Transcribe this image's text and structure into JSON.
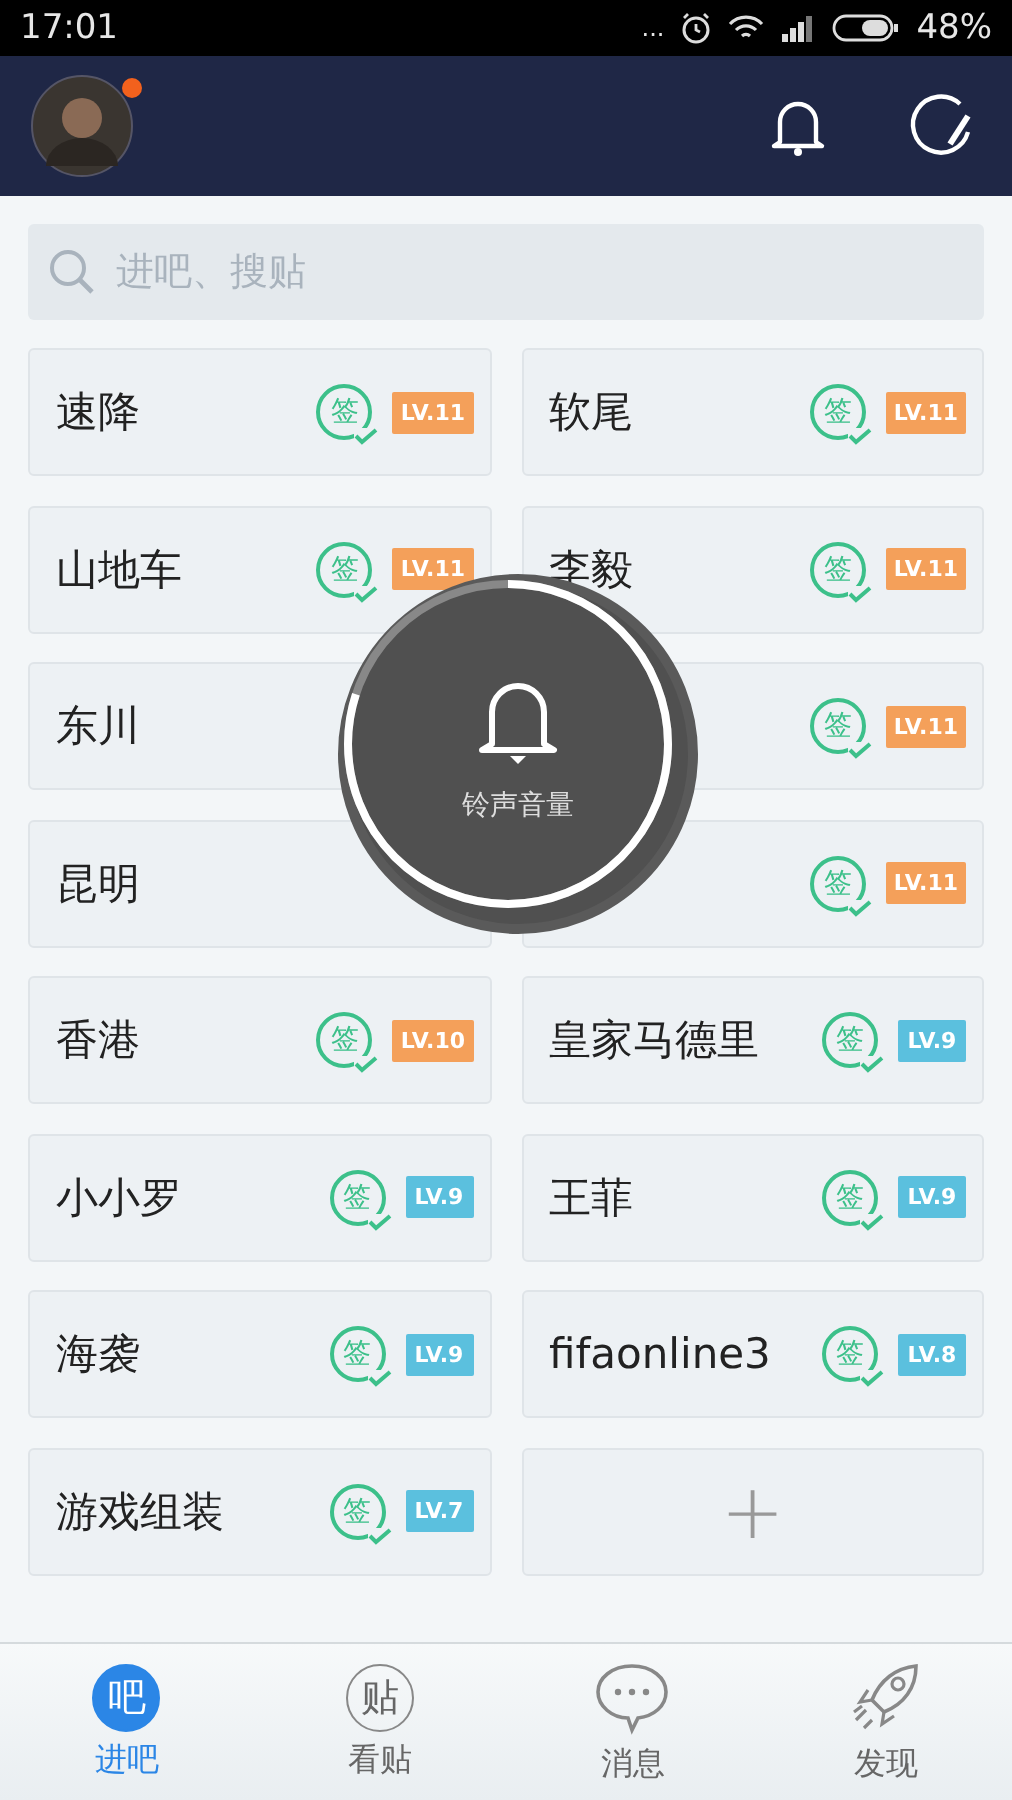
{
  "status_bar": {
    "time": "17:01",
    "dots": "...",
    "battery": "48%"
  },
  "header": {
    "avatar_badge": true
  },
  "search": {
    "placeholder": "进吧、搜贴"
  },
  "forums": [
    {
      "kind": "forum",
      "name": "速降",
      "sign": "签",
      "level_label": "LV.11",
      "color": "#f4a05a"
    },
    {
      "kind": "forum",
      "name": "软尾",
      "sign": "签",
      "level_label": "LV.11",
      "color": "#f4a05a"
    },
    {
      "kind": "forum",
      "name": "山地车",
      "sign": "签",
      "level_label": "LV.11",
      "color": "#f4a05a"
    },
    {
      "kind": "forum",
      "name": "李毅",
      "sign": "签",
      "level_label": "LV.11",
      "color": "#f4a05a"
    },
    {
      "kind": "forum",
      "name": "东川"
    },
    {
      "kind": "forum",
      "sign": "签",
      "level_label": "LV.11",
      "color": "#f4a05a"
    },
    {
      "kind": "forum",
      "name": "昆明"
    },
    {
      "kind": "forum",
      "sign": "签",
      "level_label": "LV.11",
      "color": "#f4a05a"
    },
    {
      "kind": "forum",
      "name": "香港",
      "sign": "签",
      "level_label": "LV.10",
      "color": "#f4a05a"
    },
    {
      "kind": "forum",
      "name": "皇家马德里",
      "sign": "签",
      "level_label": "LV.9",
      "color": "#5bc0de"
    },
    {
      "kind": "forum",
      "name": "小小罗",
      "sign": "签",
      "level_label": "LV.9",
      "color": "#5bc0de"
    },
    {
      "kind": "forum",
      "name": "王菲",
      "sign": "签",
      "level_label": "LV.9",
      "color": "#5bc0de"
    },
    {
      "kind": "forum",
      "name": "海袭",
      "sign": "签",
      "level_label": "LV.9",
      "color": "#5bc0de"
    },
    {
      "kind": "forum",
      "name": "fifaonline3",
      "sign": "签",
      "level_label": "LV.8",
      "color": "#5bc0de"
    },
    {
      "kind": "forum",
      "name": "游戏组装",
      "sign": "签",
      "level_label": "LV.7",
      "color": "#5bc0de"
    },
    {
      "kind": "add",
      "label": "+"
    }
  ],
  "volume_toast": {
    "label": "铃声音量",
    "level": 0.8
  },
  "tabs": [
    {
      "kind": "glyph",
      "icon_text": "吧",
      "label": "进吧",
      "selected": true
    },
    {
      "kind": "glyph",
      "icon_text": "贴",
      "label": "看贴",
      "selected": false
    },
    {
      "kind": "chat",
      "label": "消息",
      "selected": false
    },
    {
      "kind": "rocket",
      "label": "发现",
      "selected": false
    }
  ]
}
